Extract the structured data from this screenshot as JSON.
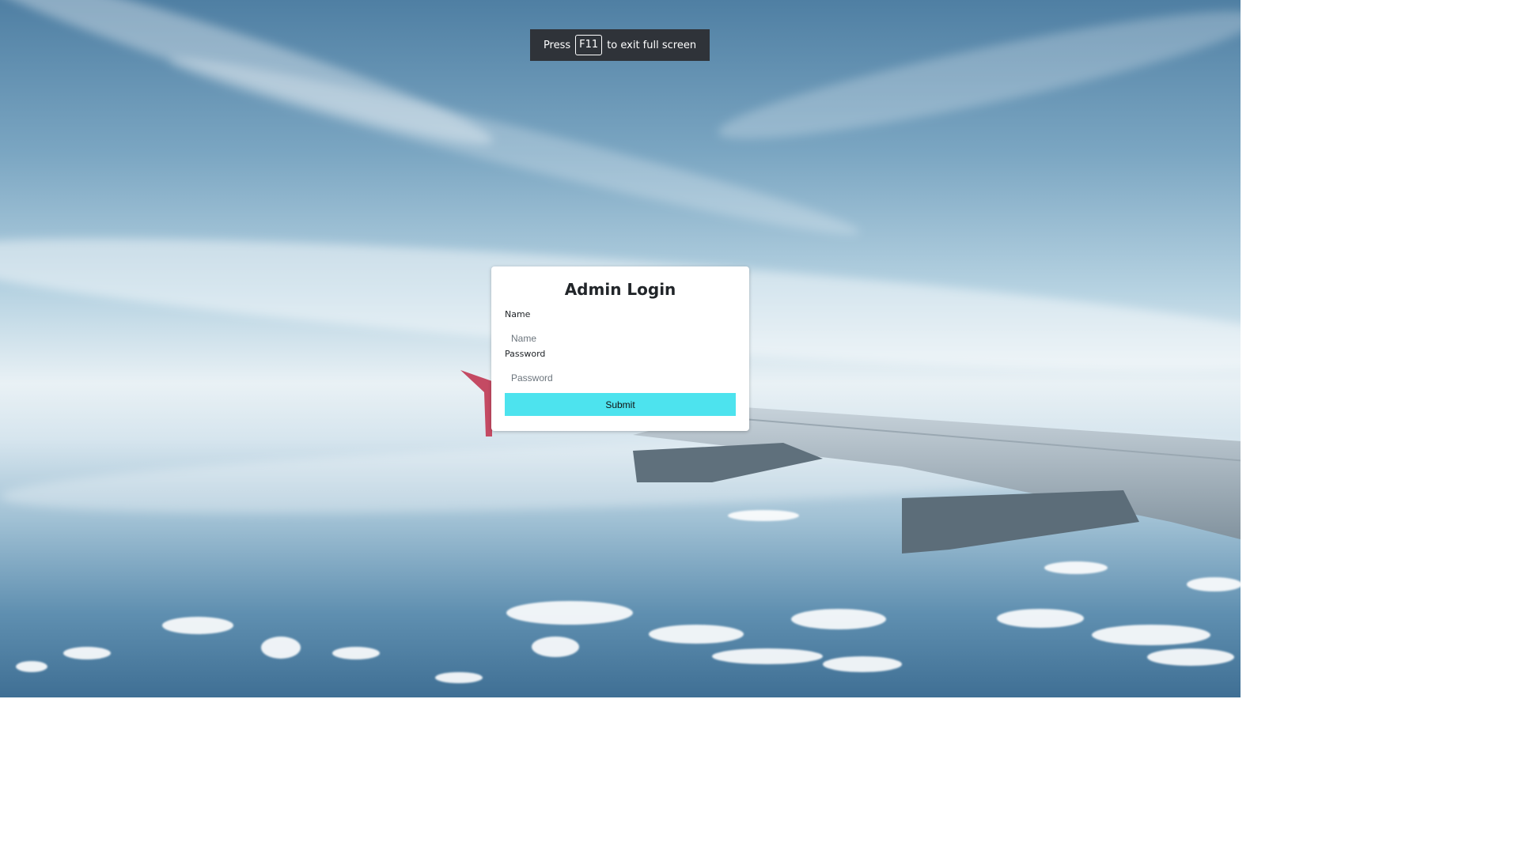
{
  "fullscreen_notice": {
    "prefix": "Press",
    "key": "F11",
    "suffix": "to exit full screen"
  },
  "login": {
    "title": "Admin Login",
    "name_label": "Name",
    "name_placeholder": "Name",
    "name_value": "",
    "password_label": "Password",
    "password_placeholder": "Password",
    "password_value": "",
    "submit_label": "Submit"
  },
  "colors": {
    "submit_bg": "#4de3ee",
    "toast_bg": "#2f3339",
    "card_bg": "#ffffff"
  }
}
